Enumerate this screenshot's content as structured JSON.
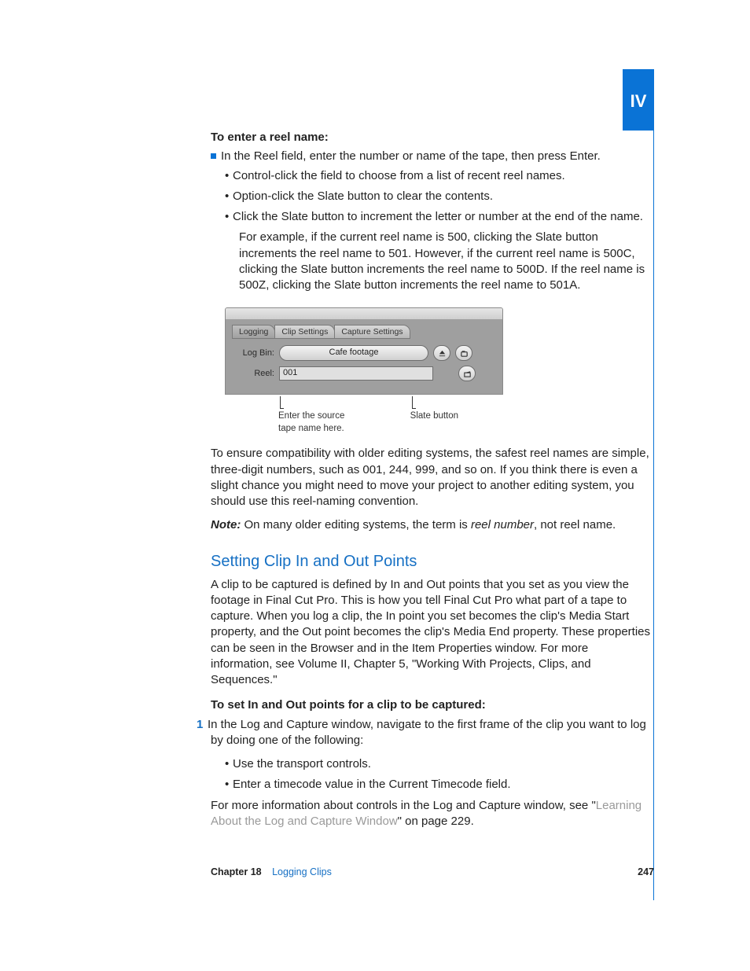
{
  "part_label": "IV",
  "sec1": {
    "heading": "To enter a reel name:",
    "main_bullet": "In the Reel field, enter the number or name of the tape, then press Enter.",
    "subs": [
      "Control-click the field to choose from a list of recent reel names.",
      "Option-click the Slate button to clear the contents.",
      "Click the Slate button to increment the letter or number at the end of the name."
    ],
    "example": "For example, if the current reel name is 500, clicking the Slate button increments the reel name to 501. However, if the current reel name is 500C, clicking the Slate button increments the reel name to 500D. If the reel name is 500Z, clicking the Slate button increments the reel name to 501A."
  },
  "ui": {
    "tabs": [
      "Logging",
      "Clip Settings",
      "Capture Settings"
    ],
    "logbin_label": "Log Bin:",
    "logbin_value": "Cafe footage",
    "reel_label": "Reel:",
    "reel_value": "001",
    "callout_left_l1": "Enter the source",
    "callout_left_l2": "tape name here.",
    "callout_right": "Slate button"
  },
  "compat_para": "To ensure compatibility with older editing systems, the safest reel names are simple, three-digit numbers, such as 001, 244, 999, and so on. If you think there is even a slight chance you might need to move your project to another editing system, you should use this reel-naming convention.",
  "note": {
    "label": "Note:",
    "before": "On many older editing systems, the term is ",
    "italic": "reel number",
    "after": ", not reel name."
  },
  "sec2": {
    "heading": "Setting Clip In and Out Points",
    "para": "A clip to be captured is defined by In and Out points that you set as you view the footage in Final Cut Pro. This is how you tell Final Cut Pro what part of a tape to capture. When you log a clip, the In point you set becomes the clip's Media Start property, and the Out point becomes the clip's Media End property. These properties can be seen in the Browser and in the Item Properties window. For more information, see Volume II, Chapter 5, \"Working With Projects, Clips, and Sequences.\"",
    "step_head": "To set In and Out points for a clip to be captured:",
    "step1_num": "1",
    "step1": "In the Log and Capture window, navigate to the first frame of the clip you want to log by doing one of the following:",
    "subs": [
      "Use the transport controls.",
      "Enter a timecode value in the Current Timecode field."
    ],
    "after_before": "For more information about controls in the Log and Capture window, see \"",
    "after_link": "Learning About the Log and Capture Window",
    "after_after": "\" on page 229."
  },
  "footer": {
    "chapter": "Chapter 18",
    "title": "Logging Clips",
    "page": "247"
  }
}
